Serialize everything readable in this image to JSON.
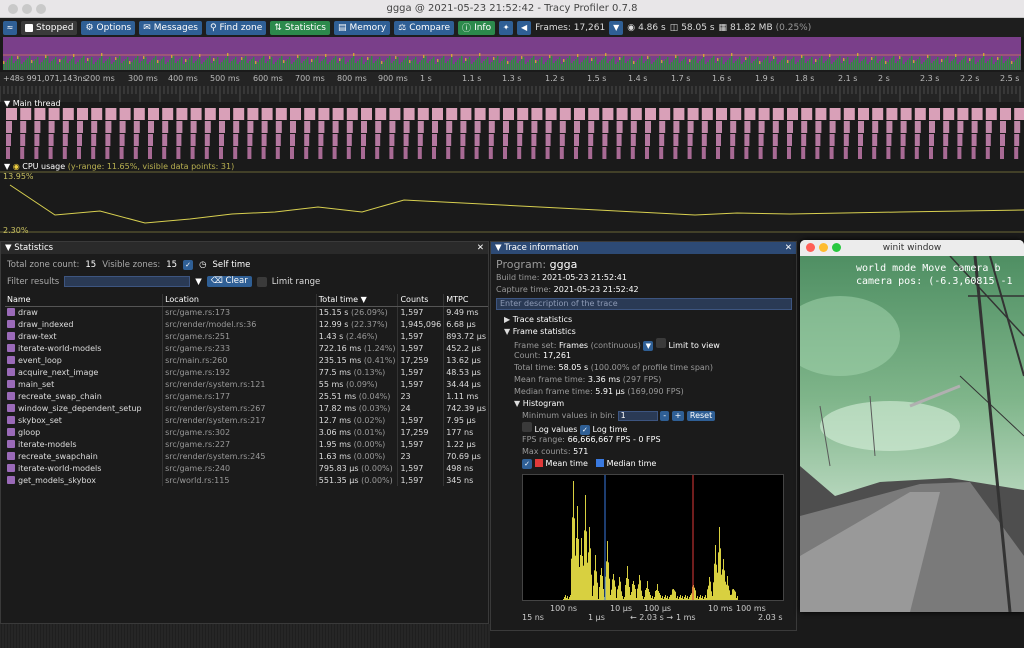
{
  "window": {
    "title": "ggga @ 2021-05-23 21:52:42 - Tracy Profiler 0.7.8"
  },
  "toolbar": {
    "stopped": "Stopped",
    "options": "Options",
    "messages": "Messages",
    "find_zone": "Find zone",
    "statistics": "Statistics",
    "memory": "Memory",
    "compare": "Compare",
    "info": "Info",
    "frames": "Frames: 17,261",
    "time": "4.86 s",
    "db": "58.05 s",
    "mem": "81.82 MB",
    "mem_pct": "(0.25%)"
  },
  "ruler": [
    "+48s 991,071,143ns",
    "300 ms",
    "500 ms",
    "700 ms",
    "900 ms",
    "1.1 s",
    "1.3 s",
    "1.5 s",
    "1.7 s",
    "1.9 s",
    "2.1 s",
    "2.3 s",
    "2.5 s",
    "200 ms",
    "400 ms",
    "600 ms",
    "800 ms",
    "1 s",
    "1.2 s",
    "1.4 s",
    "1.6 s",
    "1.8 s",
    "2 s",
    "2.2 s",
    "2.4 s"
  ],
  "main_thread": {
    "label": "Main thread"
  },
  "cpu": {
    "label": "CPU usage",
    "info": "(y-range: 11.65%, visible data points: 31)",
    "top": "13.95%",
    "bottom": "2.30%"
  },
  "statistics": {
    "title": "Statistics",
    "total_zone_label": "Total zone count:",
    "total_zone": "15",
    "visible_zones_label": "Visible zones:",
    "visible_zones": "15",
    "self_time": "Self time",
    "filter_label": "Filter results",
    "clear": "Clear",
    "limit_range": "Limit range",
    "columns": [
      "Name",
      "Location",
      "Total time",
      "Counts",
      "MTPC"
    ],
    "rows": [
      {
        "name": "draw",
        "loc": "src/game.rs:173",
        "time": "15.15 s",
        "pct": "(26.09%)",
        "count": "1,597",
        "mtpc": "9.49 ms"
      },
      {
        "name": "draw_indexed",
        "loc": "src/render/model.rs:36",
        "time": "12.99 s",
        "pct": "(22.37%)",
        "count": "1,945,096",
        "mtpc": "6.68 µs"
      },
      {
        "name": "draw-text",
        "loc": "src/game.rs:251",
        "time": "1.43 s",
        "pct": "(2.46%)",
        "count": "1,597",
        "mtpc": "893.72 µs"
      },
      {
        "name": "iterate-world-models",
        "loc": "src/game.rs:233",
        "time": "722.16 ms",
        "pct": "(1.24%)",
        "count": "1,597",
        "mtpc": "452.2 µs"
      },
      {
        "name": "event_loop",
        "loc": "src/main.rs:260",
        "time": "235.15 ms",
        "pct": "(0.41%)",
        "count": "17,259",
        "mtpc": "13.62 µs"
      },
      {
        "name": "acquire_next_image",
        "loc": "src/game.rs:192",
        "time": "77.5 ms",
        "pct": "(0.13%)",
        "count": "1,597",
        "mtpc": "48.53 µs"
      },
      {
        "name": "main_set",
        "loc": "src/render/system.rs:121",
        "time": "55 ms",
        "pct": "(0.09%)",
        "count": "1,597",
        "mtpc": "34.44 µs"
      },
      {
        "name": "recreate_swap_chain",
        "loc": "src/game.rs:177",
        "time": "25.51 ms",
        "pct": "(0.04%)",
        "count": "23",
        "mtpc": "1.11 ms"
      },
      {
        "name": "window_size_dependent_setup",
        "loc": "src/render/system.rs:267",
        "time": "17.82 ms",
        "pct": "(0.03%)",
        "count": "24",
        "mtpc": "742.39 µs"
      },
      {
        "name": "skybox_set",
        "loc": "src/render/system.rs:217",
        "time": "12.7 ms",
        "pct": "(0.02%)",
        "count": "1,597",
        "mtpc": "7.95 µs"
      },
      {
        "name": "gloop",
        "loc": "src/game.rs:302",
        "time": "3.06 ms",
        "pct": "(0.01%)",
        "count": "17,259",
        "mtpc": "177 ns"
      },
      {
        "name": "iterate-models",
        "loc": "src/game.rs:227",
        "time": "1.95 ms",
        "pct": "(0.00%)",
        "count": "1,597",
        "mtpc": "1.22 µs"
      },
      {
        "name": "recreate_swapchain",
        "loc": "src/render/system.rs:245",
        "time": "1.63 ms",
        "pct": "(0.00%)",
        "count": "23",
        "mtpc": "70.69 µs"
      },
      {
        "name": "iterate-world-models",
        "loc": "src/game.rs:240",
        "time": "795.83 µs",
        "pct": "(0.00%)",
        "count": "1,597",
        "mtpc": "498 ns"
      },
      {
        "name": "get_models_skybox",
        "loc": "src/world.rs:115",
        "time": "551.35 µs",
        "pct": "(0.00%)",
        "count": "1,597",
        "mtpc": "345 ns"
      }
    ]
  },
  "trace": {
    "title": "Trace information",
    "program_label": "Program:",
    "program": "ggga",
    "build_label": "Build time:",
    "build": "2021-05-23 21:52:41",
    "capture_label": "Capture time:",
    "capture": "2021-05-23 21:52:42",
    "desc_placeholder": "Enter description of the trace",
    "trace_stats": "Trace statistics",
    "frame_stats": "Frame statistics",
    "frame_set_label": "Frame set:",
    "frame_set": "Frames",
    "frame_set_mode": "(continuous)",
    "limit_view": "Limit to view",
    "count_label": "Count:",
    "count": "17,261",
    "total_time_label": "Total time:",
    "total_time": "58.05 s",
    "total_time_note": "(100.00% of profile time span)",
    "mean_label": "Mean frame time:",
    "mean": "3.36 ms",
    "mean_fps": "(297 FPS)",
    "median_label": "Median frame time:",
    "median": "5.91 µs",
    "median_fps": "(169,090 FPS)",
    "histogram": "Histogram",
    "min_bin_label": "Minimum values in bin:",
    "min_bin": "1",
    "minus": "-",
    "plus": "+",
    "reset": "Reset",
    "log_values": "Log values",
    "log_time": "Log time",
    "fps_range_label": "FPS range:",
    "fps_range": "66,666,667 FPS - 0 FPS",
    "max_counts_label": "Max counts:",
    "max_counts": "571",
    "mean_time": "Mean time",
    "median_time": "Median time",
    "axis": [
      "15 ns",
      "100 ns",
      "1 µs",
      "10 µs",
      "100 µs",
      "1 ms",
      "10 ms",
      "100 ms",
      "2.03 s"
    ],
    "span": "← 2.03 s →"
  },
  "winit": {
    "title": "winit window",
    "line1": "world mode Move camera b",
    "line2": "camera pos: (-6.3,60815 -1"
  },
  "colors": {
    "accent": "#2f5f95",
    "active": "#2c8a4c",
    "zone": "#9a6ab8",
    "mean": "#e03a3a",
    "median": "#3a7ae0"
  }
}
